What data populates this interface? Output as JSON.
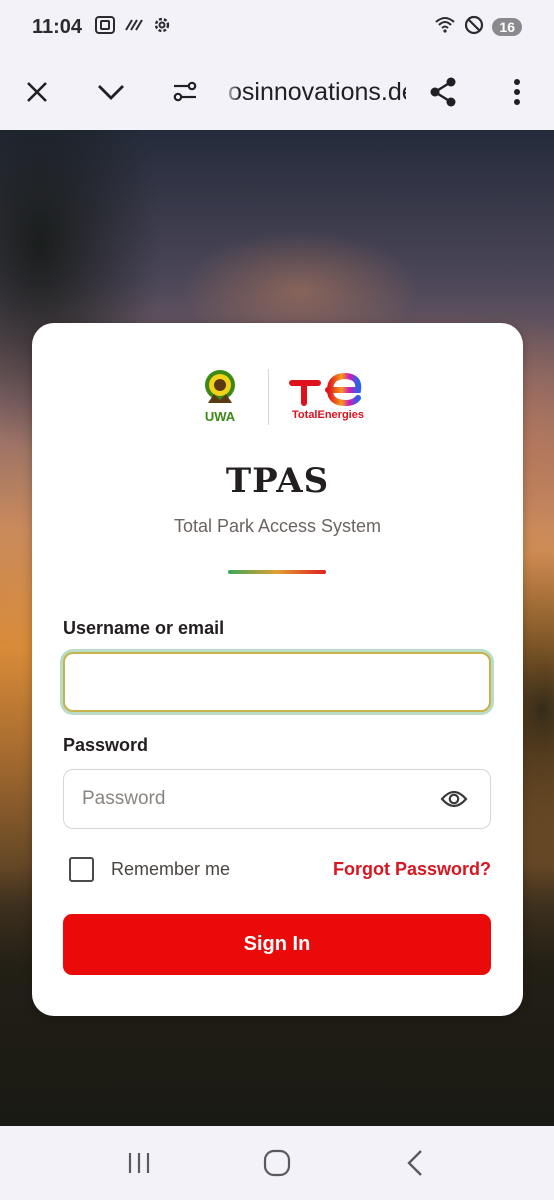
{
  "status_bar": {
    "time": "11:04",
    "notification_count": "16",
    "icons_left": [
      "screenshot-icon",
      "signal-scribble-icon",
      "settings-gear-icon"
    ],
    "icons_right": [
      "wifi-icon",
      "do-not-disturb-icon"
    ]
  },
  "browser": {
    "url": "osinnovations.dev",
    "buttons": [
      "close-icon",
      "chevron-down-icon",
      "site-settings-icon",
      "share-icon",
      "more-vert-icon"
    ]
  },
  "login": {
    "logo_uwa_text": "UWA",
    "logo_total_text": "TotalEnergies",
    "title": "TPAS",
    "subtitle": "Total Park Access System",
    "username_label": "Username or email",
    "username_value": "",
    "password_label": "Password",
    "password_placeholder": "Password",
    "remember_label": "Remember me",
    "forgot_label": "Forgot Password?",
    "signin_label": "Sign In"
  },
  "colors": {
    "accent_red": "#ea0a0a",
    "link_red": "#d81520",
    "uwa_green": "#3c8a16",
    "focus_ring": "#b9dcc6"
  },
  "nav_bar": {
    "buttons": [
      "recent-apps-icon",
      "home-icon",
      "back-icon"
    ]
  }
}
